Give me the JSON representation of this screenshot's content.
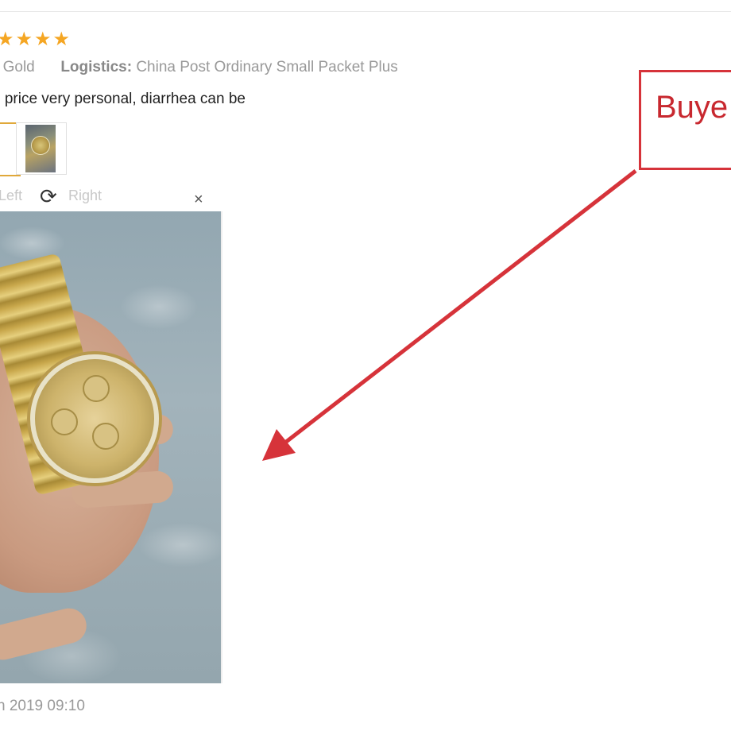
{
  "review": {
    "rating_stars": 5,
    "meta": {
      "color_label": ":",
      "color_value": "Gold",
      "logistics_label": "Logistics:",
      "logistics_value": "China Post Ordinary Small Packet Plus"
    },
    "text": "e price very personal, diarrhea can be",
    "date": "n 2019 09:10"
  },
  "viewer": {
    "rotate_left_label": "Left",
    "rotate_right_label": "Right",
    "rotate_icon": "rotate-clockwise-icon",
    "close_icon": "close-icon",
    "close_glyph": "×"
  },
  "annotation": {
    "label": "Buye",
    "color": "#d6333a"
  },
  "colors": {
    "star": "#f5a623",
    "selected_thumb_border": "#e0a83a"
  }
}
